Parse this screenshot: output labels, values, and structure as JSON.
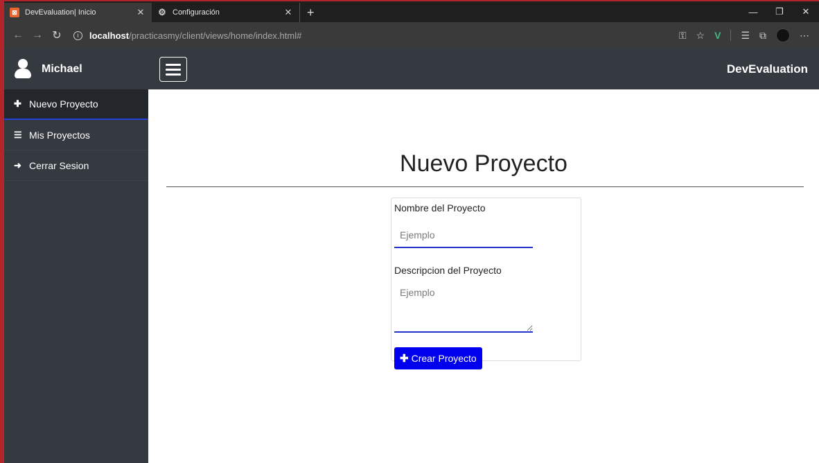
{
  "browser": {
    "tabs": [
      {
        "title": "DevEvaluation| Inicio",
        "favicon": "app-icon",
        "active": true
      },
      {
        "title": "Configuración",
        "favicon": "gear-icon",
        "active": false
      }
    ],
    "url_host": "localhost",
    "url_path": "/practicasmy/client/views/home/index.html#"
  },
  "sidebar": {
    "user_name": "Michael",
    "items": [
      {
        "label": "Nuevo Proyecto",
        "icon": "plus-icon"
      },
      {
        "label": "Mis Proyectos",
        "icon": "list-icon"
      },
      {
        "label": "Cerrar Sesion",
        "icon": "sign-out-icon"
      }
    ]
  },
  "topbar": {
    "brand": "DevEvaluation"
  },
  "main": {
    "title": "Nuevo Proyecto",
    "form": {
      "name_label": "Nombre del Proyecto",
      "name_placeholder": "Ejemplo",
      "desc_label": "Descripcion del Proyecto",
      "desc_placeholder": "Ejemplo",
      "submit_label": "Crear Proyecto"
    }
  },
  "colors": {
    "sidebar_bg": "#343a40",
    "accent": "#0000ee",
    "underline": "#2233cc"
  }
}
